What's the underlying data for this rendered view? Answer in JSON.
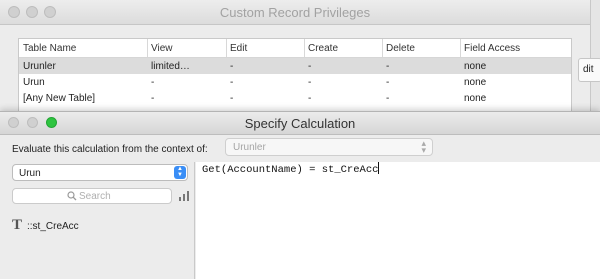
{
  "privileges_window": {
    "title": "Custom Record Privileges",
    "columns": [
      "Table Name",
      "View",
      "Edit",
      "Create",
      "Delete",
      "Field Access"
    ],
    "rows": [
      {
        "table": "Urunler",
        "view": "limited…",
        "edit": "-",
        "create": "-",
        "delete": "-",
        "field_access": "none",
        "selected": true
      },
      {
        "table": "Urun",
        "view": "-",
        "edit": "-",
        "create": "-",
        "delete": "-",
        "field_access": "none",
        "selected": false
      },
      {
        "table": "[Any New Table]",
        "view": "-",
        "edit": "-",
        "create": "-",
        "delete": "-",
        "field_access": "none",
        "selected": false
      }
    ],
    "side_button_fragment": "dit"
  },
  "calc_window": {
    "title": "Specify Calculation",
    "context_label": "Evaluate this calculation from the context of:",
    "context_value": "Urunler",
    "table_selector_value": "Urun",
    "search_placeholder": "Search",
    "fields": [
      {
        "icon": "text-field-icon",
        "label": "::st_CreAcc"
      }
    ],
    "formula": "Get(AccountName) = st_CreAcc"
  },
  "colors": {
    "close_gray": "#d0d0d0",
    "zoom_green": "#2ec440",
    "selection_row": "#dcdcdc",
    "stepper_blue": "#3a8ef6"
  }
}
